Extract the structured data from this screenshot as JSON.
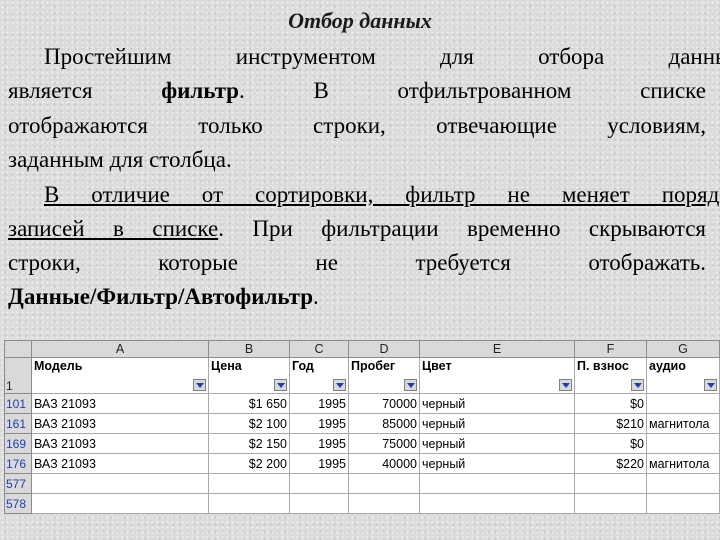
{
  "title": "Отбор данных",
  "paragraph1": {
    "line1": "Простейшим инструментом для отбора данных",
    "line2_a": "является ",
    "line2_bold": "фильтр",
    "line2_b": ". В отфильтрованном списке",
    "line3": "отображаются только строки, отвечающие условиям,",
    "line4": "заданным для столбца."
  },
  "paragraph2": {
    "line1_underlined": "В отличие от сортировки, фильтр не меняет порядок",
    "line2_underlined": "записей в списке",
    "line2_rest": ". При фильтрации временно скрываются",
    "line3": "строки, которые не требуется отображать.",
    "line4_bold": "Данные/Фильтр/Автофильтр",
    "line4_rest": "."
  },
  "spreadsheet": {
    "column_letters": [
      "A",
      "B",
      "C",
      "D",
      "E",
      "F",
      "G"
    ],
    "header_row_number": "1",
    "headers": [
      "Модель",
      "Цена",
      "Год",
      "Пробег",
      "Цвет",
      "П. взнос",
      "аудио"
    ],
    "rows": [
      {
        "num": "101",
        "cells": [
          "ВАЗ 21093",
          "$1 650",
          "1995",
          "70000",
          "черный",
          "$0",
          ""
        ]
      },
      {
        "num": "161",
        "cells": [
          "ВАЗ 21093",
          "$2 100",
          "1995",
          "85000",
          "черный",
          "$210",
          "магнитола"
        ]
      },
      {
        "num": "169",
        "cells": [
          "ВАЗ 21093",
          "$2 150",
          "1995",
          "75000",
          "черный",
          "$0",
          ""
        ]
      },
      {
        "num": "176",
        "cells": [
          "ВАЗ 21093",
          "$2 200",
          "1995",
          "40000",
          "черный",
          "$220",
          "магнитола"
        ]
      },
      {
        "num": "577",
        "cells": [
          "",
          "",
          "",
          "",
          "",
          "",
          ""
        ]
      },
      {
        "num": "578",
        "cells": [
          "",
          "",
          "",
          "",
          "",
          "",
          ""
        ]
      }
    ]
  }
}
